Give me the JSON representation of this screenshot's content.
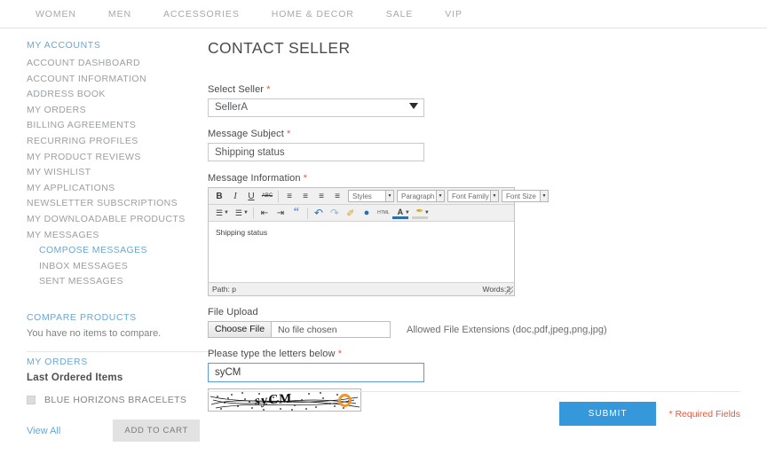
{
  "topnav": {
    "items": [
      {
        "label": "WOMEN"
      },
      {
        "label": "MEN"
      },
      {
        "label": "ACCESSORIES"
      },
      {
        "label": "HOME & DECOR"
      },
      {
        "label": "SALE"
      },
      {
        "label": "VIP"
      }
    ]
  },
  "sidebar": {
    "heading": "MY ACCOUNTS",
    "items": [
      {
        "label": "ACCOUNT DASHBOARD"
      },
      {
        "label": "ACCOUNT INFORMATION"
      },
      {
        "label": "ADDRESS BOOK"
      },
      {
        "label": "MY ORDERS"
      },
      {
        "label": "BILLING AGREEMENTS"
      },
      {
        "label": "RECURRING PROFILES"
      },
      {
        "label": "MY PRODUCT REVIEWS"
      },
      {
        "label": "MY WISHLIST"
      },
      {
        "label": "MY APPLICATIONS"
      },
      {
        "label": "NEWSLETTER SUBSCRIPTIONS"
      },
      {
        "label": "MY DOWNLOADABLE PRODUCTS"
      },
      {
        "label": "MY MESSAGES"
      }
    ],
    "subitems": [
      {
        "label": "COMPOSE MESSAGES",
        "active": true
      },
      {
        "label": "INBOX MESSAGES",
        "active": false
      },
      {
        "label": "SENT MESSAGES",
        "active": false
      }
    ],
    "compare": {
      "heading": "COMPARE PRODUCTS",
      "empty_text": "You have no items to compare."
    },
    "orders": {
      "heading": "MY ORDERS",
      "subheading": "Last Ordered Items",
      "product": "BLUE HORIZONS BRACELETS",
      "view_all": "View All",
      "add_to_cart": "ADD TO CART"
    }
  },
  "main": {
    "title": "CONTACT SELLER",
    "select_seller": {
      "label": "Select Seller",
      "required_mark": "*",
      "value": "SellerA"
    },
    "message_subject": {
      "label": "Message Subject",
      "required_mark": "*",
      "value": "Shipping status",
      "placeholder": ""
    },
    "message_information": {
      "label": "Message Information",
      "required_mark": "*",
      "body_text": "Shipping status",
      "path_label": "Path: p",
      "words_label": "Words:2"
    },
    "editor_toolbar": {
      "row1_buttons": [
        {
          "name": "bold-icon",
          "glyph": "B"
        },
        {
          "name": "italic-icon",
          "glyph": "I"
        },
        {
          "name": "underline-icon",
          "glyph": "U"
        },
        {
          "name": "strikethrough-icon",
          "glyph": "ABC"
        },
        {
          "name": "align-left-icon",
          "glyph": "≡"
        },
        {
          "name": "align-center-icon",
          "glyph": "≡"
        },
        {
          "name": "align-right-icon",
          "glyph": "≡"
        },
        {
          "name": "align-justify-icon",
          "glyph": "≡"
        }
      ],
      "selects": [
        {
          "name": "styles-select",
          "label": "Styles"
        },
        {
          "name": "paragraph-select",
          "label": "Paragraph"
        },
        {
          "name": "font-family-select",
          "label": "Font Family"
        },
        {
          "name": "font-size-select",
          "label": "Font Size"
        }
      ],
      "row2_buttons": [
        {
          "name": "bullet-list-icon",
          "glyph": "☰"
        },
        {
          "name": "numbered-list-icon",
          "glyph": "☰"
        },
        {
          "name": "outdent-icon",
          "glyph": "⇤"
        },
        {
          "name": "indent-icon",
          "glyph": "⇥"
        },
        {
          "name": "blockquote-icon",
          "glyph": "“"
        },
        {
          "name": "undo-icon",
          "glyph": "↶"
        },
        {
          "name": "redo-icon",
          "glyph": "↷"
        },
        {
          "name": "cleanup-icon",
          "glyph": "✐"
        },
        {
          "name": "insert-link-icon",
          "glyph": "●"
        },
        {
          "name": "edit-html-icon",
          "glyph": "HTML"
        },
        {
          "name": "text-color-icon",
          "glyph": "A"
        },
        {
          "name": "background-color-icon",
          "glyph": "✒"
        }
      ]
    },
    "file_upload": {
      "label": "File Upload",
      "choose_button": "Choose File",
      "no_file_text": "No file chosen",
      "allowed_text": "Allowed File Extensions (doc,pdf,jpeg,png,jpg)"
    },
    "captcha": {
      "label": "Please type the letters below",
      "required_mark": "*",
      "value": "syCM",
      "image_text": "syCM",
      "refresh_icon": "refresh-icon"
    },
    "submit": {
      "button_label": "SUBMIT",
      "required_note": "* Required Fields"
    }
  },
  "colors": {
    "accent_blue": "#3598db",
    "link_blue": "#6aa7d4",
    "required_red": "#e9573f",
    "muted_gray": "#9a9ea2",
    "captcha_orange": "#f0962c"
  }
}
